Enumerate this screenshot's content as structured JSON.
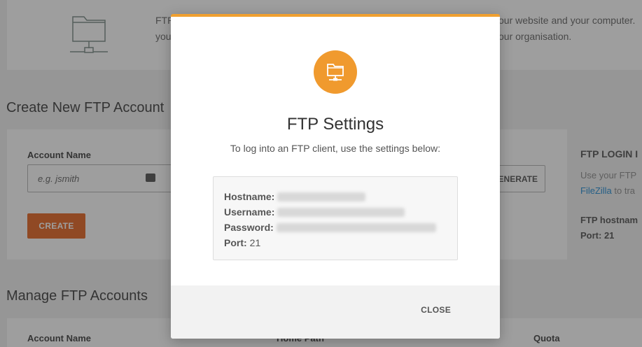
{
  "intro": {
    "left_line1": "FTP",
    "left_line2": "you",
    "right_line1": "our website and your computer.",
    "right_line2": "our organisation."
  },
  "create_section": {
    "title": "Create New FTP Account",
    "account_name_label": "Account Name",
    "account_name_placeholder": "e.g. jsmith",
    "create_button": "CREATE",
    "generate_button": "ENERATE"
  },
  "login_panel": {
    "title": "FTP LOGIN I",
    "text_line1": "Use your FTP",
    "link": "FileZilla",
    "text_line2_suffix": " to tra",
    "hostname_label": "FTP hostnam",
    "port_label": "Port: 21"
  },
  "manage_section": {
    "title": "Manage FTP Accounts",
    "columns": [
      "Account Name",
      "Home Path",
      "Quota"
    ]
  },
  "modal": {
    "title": "FTP Settings",
    "subtitle": "To log into an FTP client, use the settings below:",
    "hostname_label": "Hostname:",
    "username_label": "Username:",
    "password_label": "Password:",
    "port_label": "Port:",
    "port_value": "21",
    "close_button": "CLOSE",
    "icon": "ftp-folder-network-icon",
    "accent_color": "#f09a2e"
  }
}
